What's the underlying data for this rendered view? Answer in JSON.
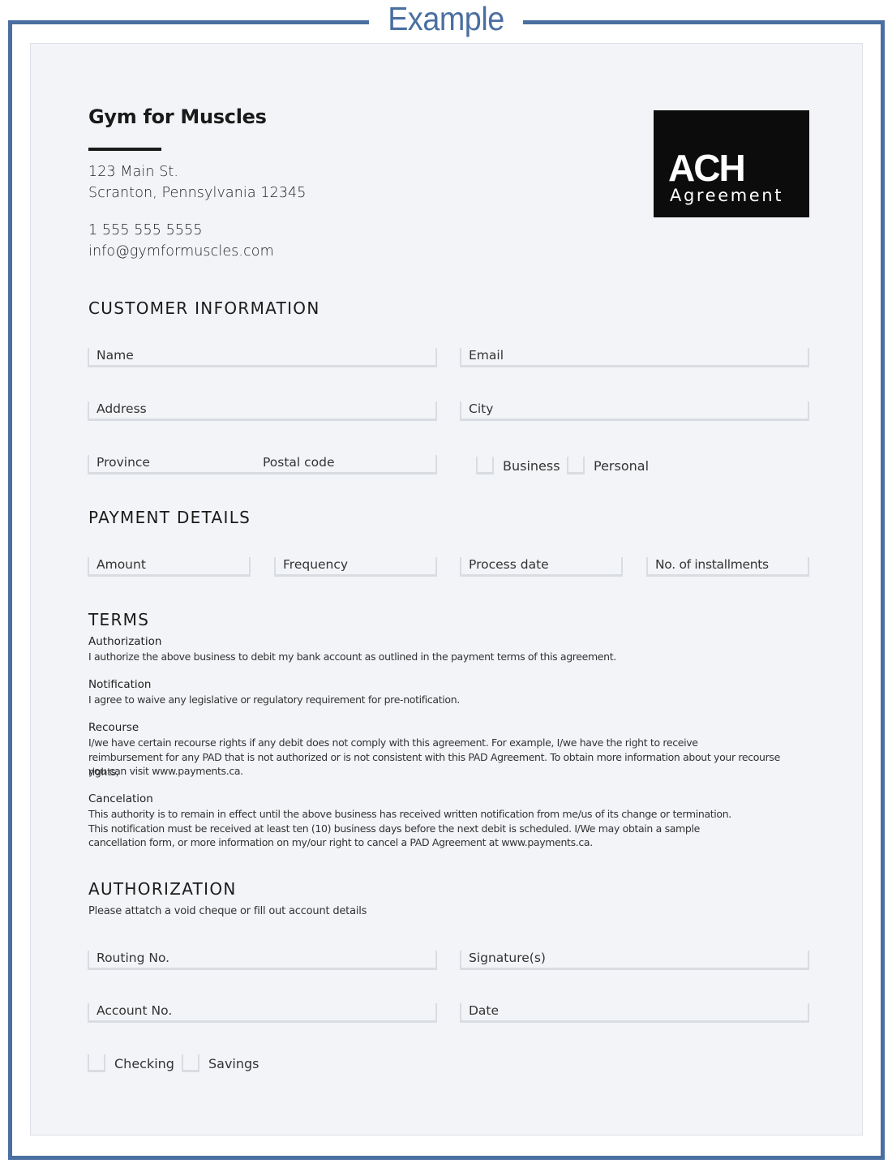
{
  "frame": {
    "title": "Example",
    "accent_color": "#4a6fa1"
  },
  "header": {
    "company_name": "Gym for Muscles",
    "address_line1": "123 Main St.",
    "address_line2": "Scranton, Pennsylvania 12345",
    "phone": "1 555 555 5555",
    "email": "info@gymformuscles.com"
  },
  "logo": {
    "title": "ACH",
    "subtitle": "Agreement"
  },
  "customer_information": {
    "heading": "CUSTOMER INFORMATION",
    "fields": {
      "name": "Name",
      "email": "Email",
      "address": "Address",
      "city": "City",
      "province": "Province",
      "postal_code": "Postal code"
    },
    "account_type_options": [
      "Business",
      "Personal"
    ]
  },
  "payment_details": {
    "heading": "PAYMENT DETAILS",
    "fields": [
      "Amount",
      "Frequency",
      "Process date",
      "No. of installments"
    ]
  },
  "terms": {
    "heading": "TERMS",
    "items": [
      {
        "title": "Authorization",
        "body": "I authorize the above business to debit my bank account as outlined in the payment terms of this agreement."
      },
      {
        "title": "Notification",
        "body": "I agree to waive any legislative or regulatory requirement for pre-notification."
      },
      {
        "title": "Recourse",
        "body_lines": [
          "I/we have certain recourse rights if any debit does not comply with this agreement. For example, I/we have the right to receive",
          "reimbursement for any PAD that is not authorized or is not consistent with this PAD Agreement. To obtain more information about your recourse rights,",
          "you can visit www.payments.ca."
        ]
      },
      {
        "title": "Cancelation",
        "body_lines": [
          "This authority is to remain in effect until the above business has received written notification from me/us of its change or termination.",
          "This notification must be received at least ten (10) business days before the next debit is scheduled. I/We may obtain a sample",
          "cancellation form, or more information on my/our right to cancel a PAD Agreement at www.payments.ca."
        ]
      }
    ]
  },
  "authorization": {
    "heading": "AUTHORIZATION",
    "subtitle": "Please attatch a void cheque or fill out account details",
    "fields": {
      "routing_no": "Routing No.",
      "signature": "Signature(s)",
      "account_no": "Account No.",
      "date": "Date"
    },
    "account_kind_options": [
      "Checking",
      "Savings"
    ]
  }
}
